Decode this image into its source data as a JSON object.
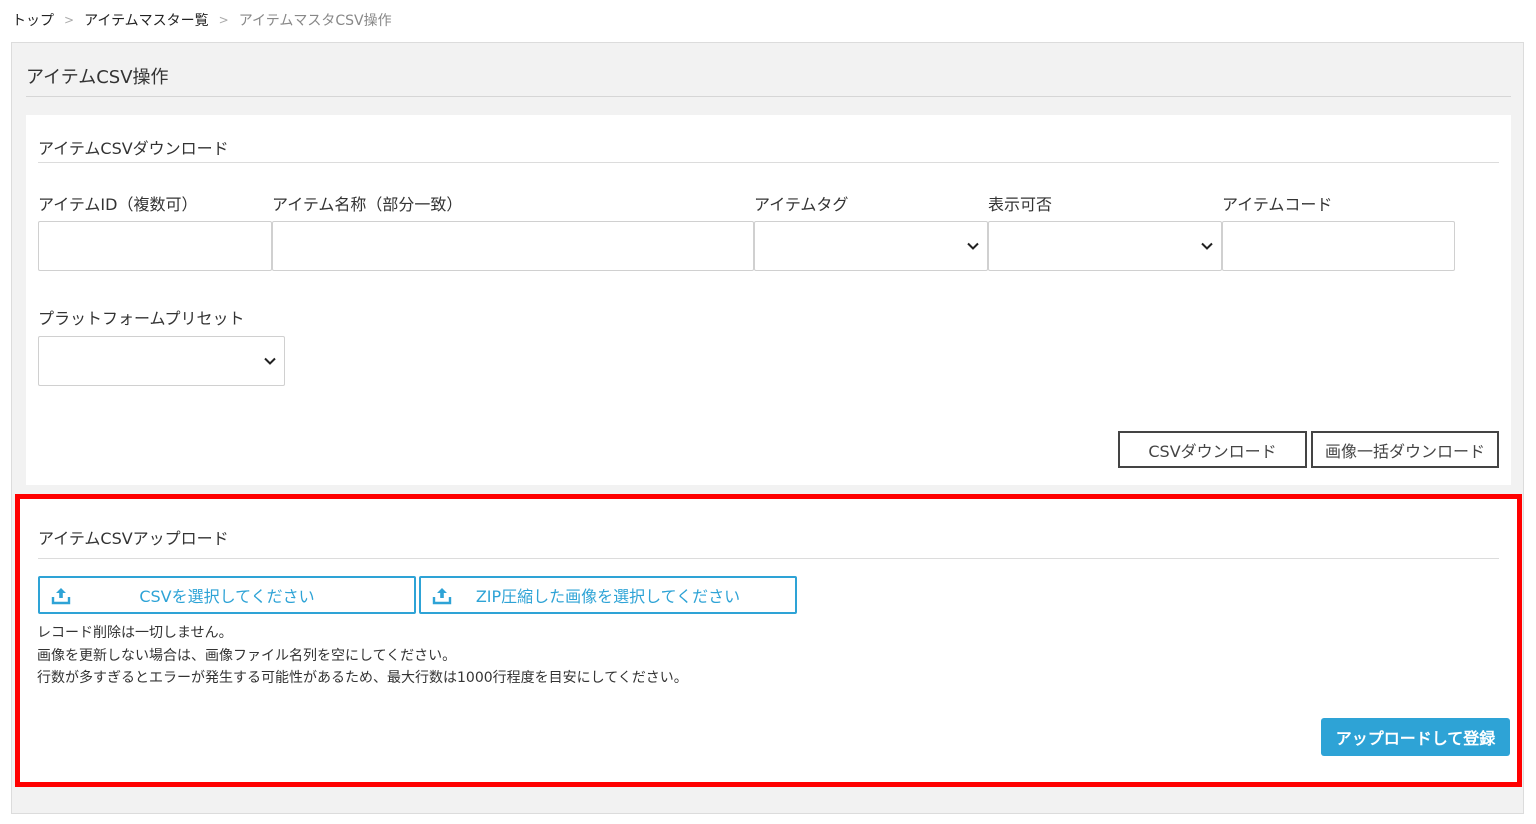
{
  "breadcrumb": [
    {
      "label": "トップ"
    },
    {
      "label": "アイテムマスター覧"
    },
    {
      "label": "アイテムマスタCSV操作"
    }
  ],
  "breadcrumb_separator": ">",
  "page": {
    "title": "アイテムCSV操作"
  },
  "download": {
    "title": "アイテムCSVダウンロード",
    "fields": {
      "item_id": {
        "label": "アイテムID（複数可）",
        "value": ""
      },
      "item_name": {
        "label": "アイテム名称（部分一致）",
        "value": ""
      },
      "item_tag": {
        "label": "アイテムタグ",
        "value": ""
      },
      "display": {
        "label": "表示可否",
        "value": ""
      },
      "item_code": {
        "label": "アイテムコード",
        "value": ""
      },
      "platform_preset": {
        "label": "プラットフォームプリセット",
        "value": ""
      }
    },
    "csv_download_label": "CSVダウンロード",
    "image_download_label": "画像一括ダウンロード"
  },
  "upload": {
    "title": "アイテムCSVアップロード",
    "select_csv_label": "CSVを選択してください",
    "select_zip_label": "ZIP圧縮した画像を選択してください",
    "notes": [
      "レコード削除は一切しません。",
      "画像を更新しない場合は、画像ファイル名列を空にしてください。",
      "行数が多すぎるとエラーが発生する可能性があるため、最大行数は1000行程度を目安にしてください。"
    ],
    "submit_label": "アップロードして登録"
  },
  "colors": {
    "accent": "#2ea3d6",
    "highlight_border": "#ff0000",
    "outer_bg": "#f2f2f2"
  },
  "icons": {
    "upload": "upload-icon",
    "select": "chevron-down-icon"
  }
}
